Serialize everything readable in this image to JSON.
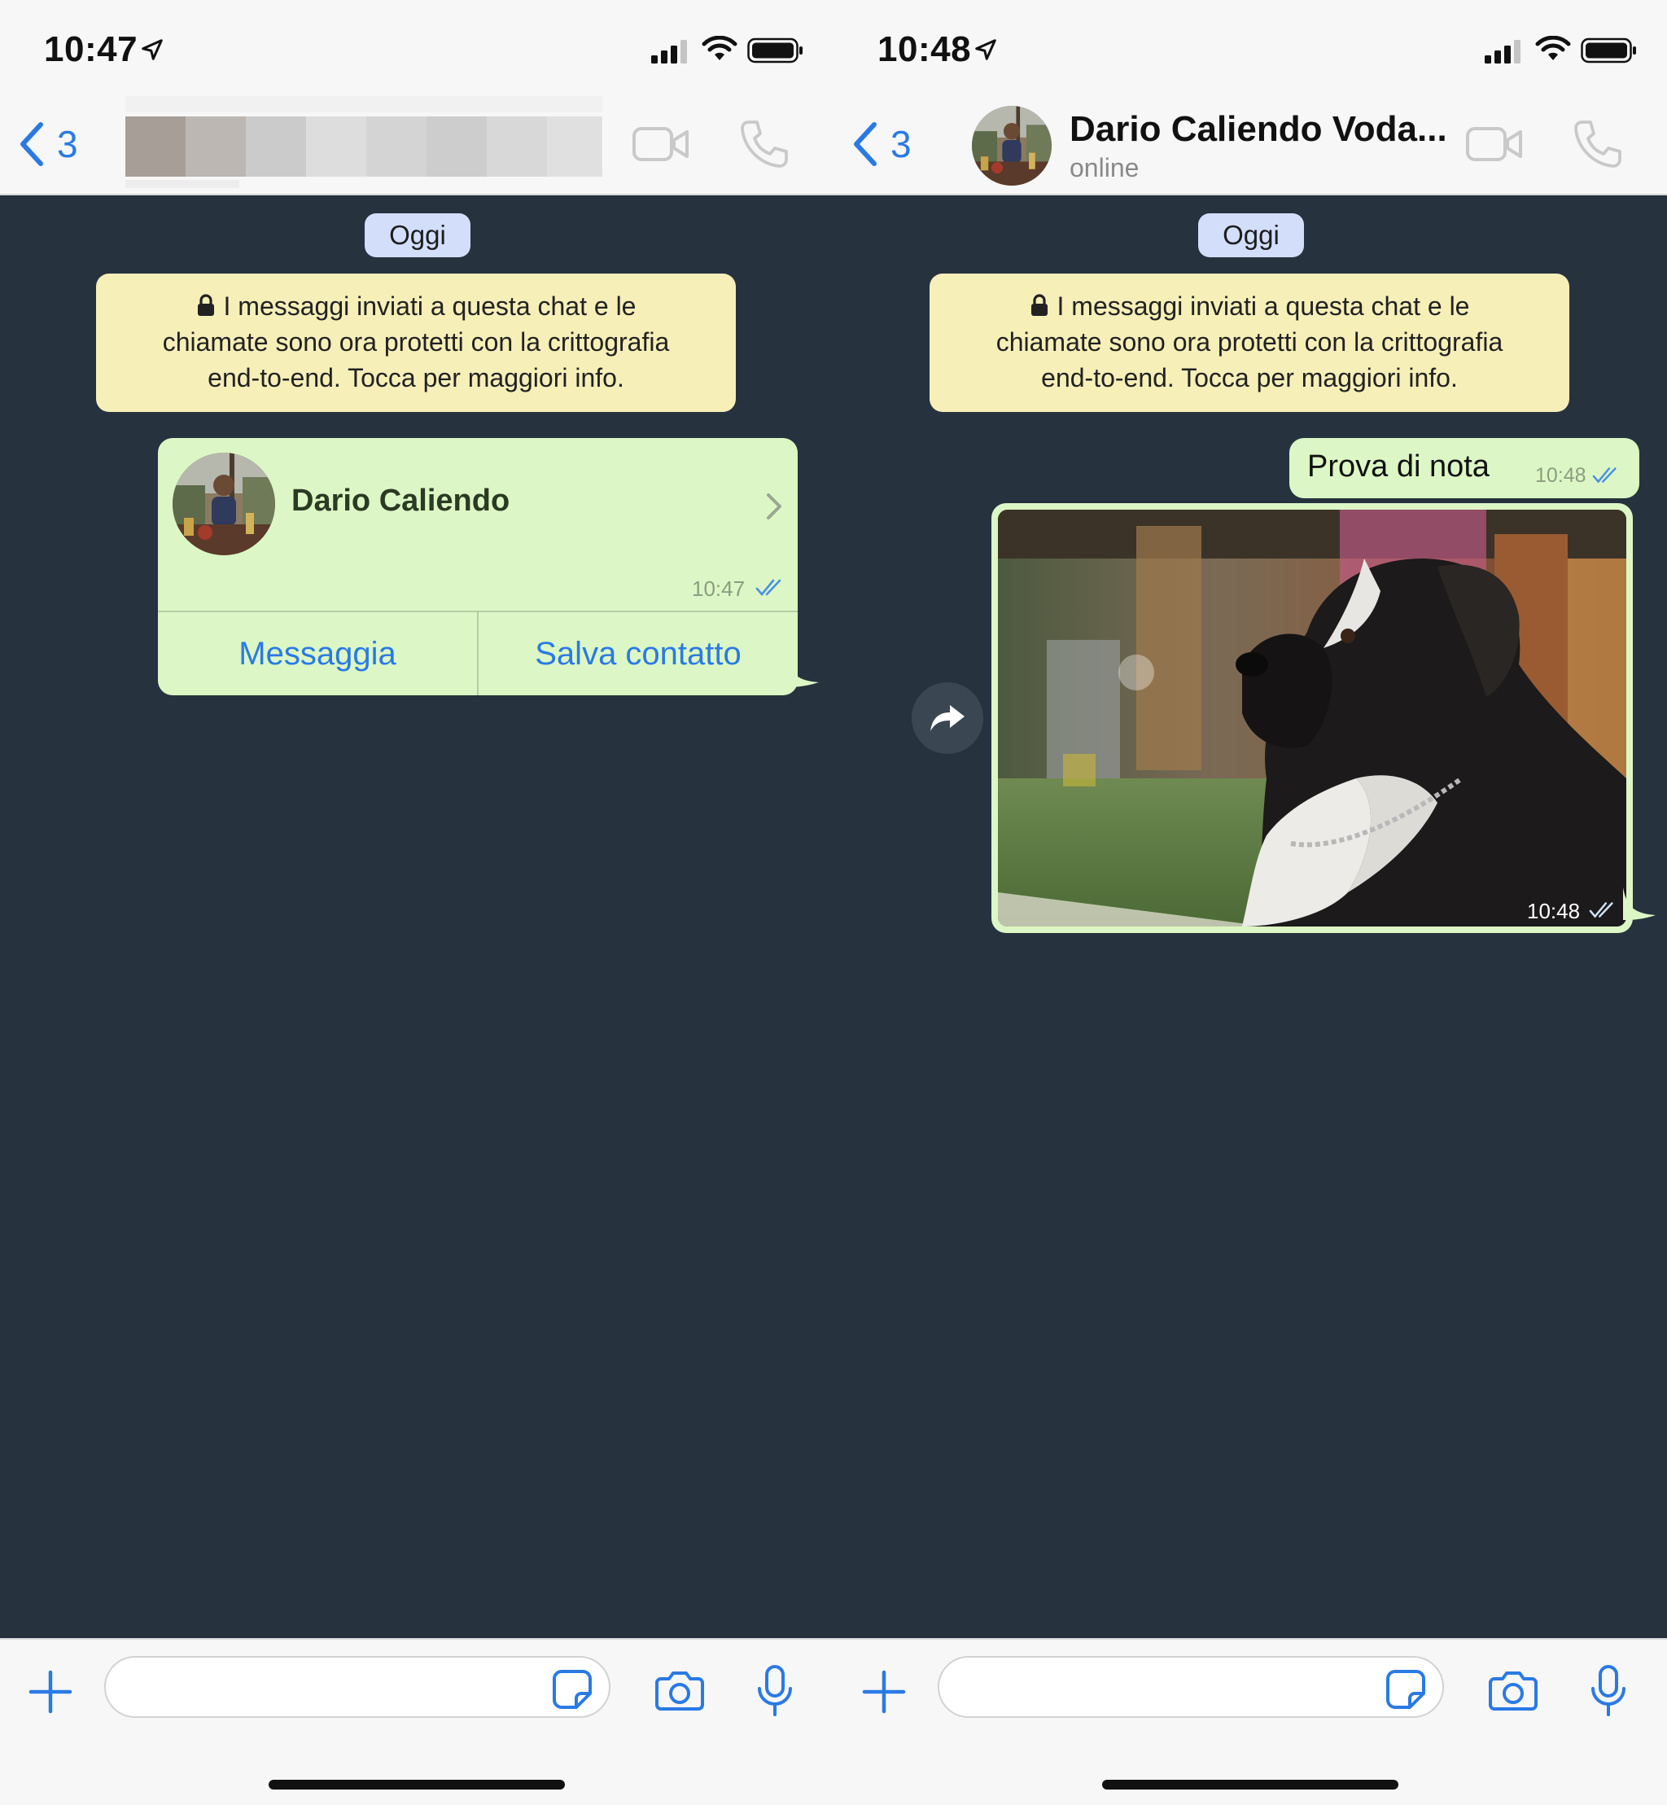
{
  "left_screen": {
    "status": {
      "time": "10:47"
    },
    "nav": {
      "back_count": "3"
    },
    "chat": {
      "date_label": "Oggi",
      "security_line1": "I messaggi inviati a questa chat e le",
      "security_line2": "chiamate sono ora protetti con la crittografia",
      "security_line3": "end-to-end. Tocca per maggiori info.",
      "contact_card": {
        "name": "Dario Caliendo",
        "time": "10:47",
        "action_message": "Messaggia",
        "action_save": "Salva contatto"
      }
    },
    "input": {
      "placeholder": ""
    }
  },
  "right_screen": {
    "status": {
      "time": "10:48"
    },
    "nav": {
      "back_count": "3",
      "contact_name": "Dario Caliendo Voda...",
      "contact_status": "online"
    },
    "chat": {
      "date_label": "Oggi",
      "security_line1": "I messaggi inviati a questa chat e le",
      "security_line2": "chiamate sono ora protetti con la crittografia",
      "security_line3": "end-to-end. Tocca per maggiori info.",
      "text_message": {
        "text": "Prova di nota",
        "time": "10:48"
      },
      "image_message": {
        "time": "10:48"
      }
    },
    "input": {
      "placeholder": ""
    }
  },
  "colors": {
    "chat_background": "#26323e",
    "bubble_outgoing": "#dcf7c5",
    "system_note": "#f6efb8",
    "date_pill": "#d3defb",
    "accent_blue": "#2a7ae4",
    "read_check": "#4a90e2"
  },
  "icons": [
    "location-arrow-icon",
    "signal-icon",
    "wifi-icon",
    "battery-icon",
    "back-chevron-icon",
    "video-call-icon",
    "phone-call-icon",
    "lock-icon",
    "chevron-right-icon",
    "double-check-icon",
    "forward-icon",
    "plus-icon",
    "sticker-icon",
    "camera-icon",
    "microphone-icon"
  ]
}
